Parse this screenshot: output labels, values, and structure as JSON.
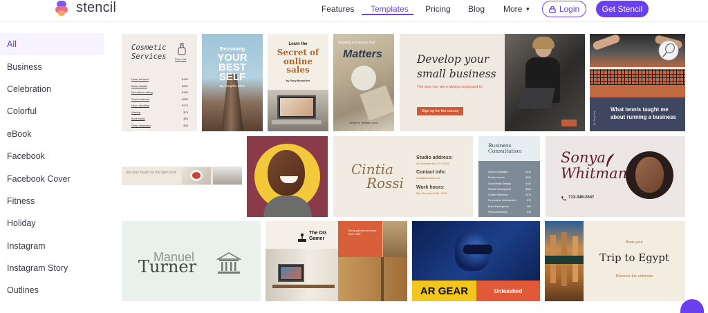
{
  "brand": {
    "name": "stencil"
  },
  "nav": {
    "features": "Features",
    "templates": "Templates",
    "pricing": "Pricing",
    "blog": "Blog",
    "more": "More",
    "login": "Login",
    "get_stencil": "Get Stencil"
  },
  "sidebar": {
    "items": [
      {
        "label": "All"
      },
      {
        "label": "Business"
      },
      {
        "label": "Celebration"
      },
      {
        "label": "Colorful"
      },
      {
        "label": "eBook"
      },
      {
        "label": "Facebook"
      },
      {
        "label": "Facebook Cover"
      },
      {
        "label": "Fitness"
      },
      {
        "label": "Holiday"
      },
      {
        "label": "Instagram"
      },
      {
        "label": "Instagram Story"
      },
      {
        "label": "Outlines"
      }
    ]
  },
  "templates": {
    "cosmetic": {
      "title": "Cosmetic Services",
      "price_list": "Price List",
      "rows": [
        {
          "name": "Laser infusion",
          "price": "$120"
        },
        {
          "name": "Botox facials",
          "price": "$300"
        },
        {
          "name": "Microderm rolling",
          "price": "$150"
        },
        {
          "name": "Scar treatment",
          "price": "$250"
        },
        {
          "name": "Micro needling",
          "price": "$175"
        },
        {
          "name": "Waxing",
          "price": "$75"
        },
        {
          "name": "Acne facial",
          "price": "$50"
        },
        {
          "name": "Deep cleansing",
          "price": "$45"
        }
      ]
    },
    "best_self": {
      "line1": "Becoming",
      "line2": "YOUR BEST SELF",
      "author": "By Seraphin Blind"
    },
    "online_sales": {
      "kicker": "Learn the",
      "title": "Secret of online sales",
      "author": "by Gary Brookline"
    },
    "matters": {
      "kicker": "Growing a business that",
      "title": "Matters",
      "author": "Written by Raphael Lucero"
    },
    "develop": {
      "title": "Develop your small business",
      "subtitle": "The way you were always supposed to",
      "cta": "Sign up for the course"
    },
    "tennis": {
      "title": "What tennis taught me about running a business",
      "side": "Dr. Terry Zeh"
    },
    "health": {
      "text": "Get your health on the right track"
    },
    "cintia": {
      "name1": "Cintia",
      "name2": "Rossi",
      "studio_label": "Studio address:",
      "studio_value": "46 Bushwick Ave, NY 11203",
      "contact_label": "Contact info:",
      "contact_value": "cintia@example.com",
      "hours_label": "Work hours:",
      "hours_value": "Mon-Sun from 9AM - 6PM"
    },
    "consultation": {
      "title": "Business Consultation",
      "rows": [
        {
          "name": "Social Consultation",
          "price": "$120"
        },
        {
          "name": "Product Launch",
          "price": "$300"
        },
        {
          "name": "Social Media Strategy",
          "price": "$150"
        },
        {
          "name": "Website Development",
          "price": "$250"
        },
        {
          "name": "Content Marketing",
          "price": "$175"
        },
        {
          "name": "E-commerce Development",
          "price": "$75"
        },
        {
          "name": "Brand Development",
          "price": "$50"
        },
        {
          "name": "Personal Branding",
          "price": "$45"
        }
      ]
    },
    "sonya": {
      "name1": "Sonya",
      "name2": "Whitman",
      "phone": "713-346-2647"
    },
    "manuel": {
      "first": "Manuel",
      "last": "Turner"
    },
    "gamer": {
      "title": "The OG Gamer",
      "orange": "Taking gaming seriously since 1985"
    },
    "ar_gear": {
      "left": "AR GEAR",
      "right": "Unleashed"
    },
    "egypt": {
      "book": "Book your",
      "title": "Trip to Egypt",
      "discover": "Discover the unknown"
    }
  },
  "colors": {
    "accent": "#6a3ff0",
    "sidebar_active_bg": "#f6f2ff",
    "develop_orange": "#cf5a3a",
    "tennis_navy": "#3f4660",
    "sonya_plum": "#5c1f31",
    "ar_yellow": "#f3c61e",
    "ar_orange": "#e2593a"
  }
}
